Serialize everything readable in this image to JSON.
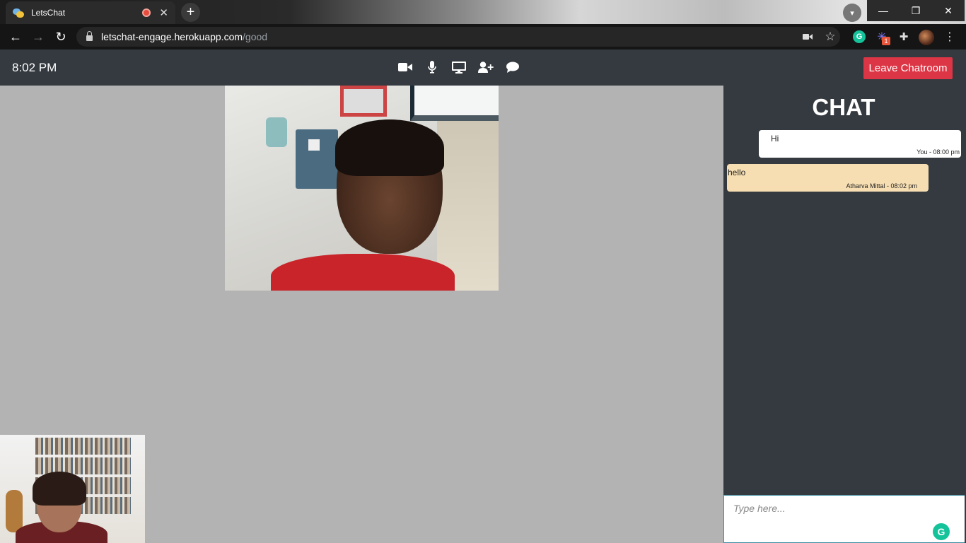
{
  "browser": {
    "tab": {
      "title": "LetsChat"
    },
    "new_tab_symbol": "+",
    "window_controls": {
      "minimize": "—",
      "restore": "❐",
      "close": "✕"
    },
    "nav": {
      "back": "←",
      "forward": "→",
      "reload": "↻"
    },
    "url": {
      "host": "letschat-engage.herokuapp.com",
      "path": "/good"
    },
    "extensions": {
      "grammarly_letter": "G",
      "badge_count": "1"
    }
  },
  "app": {
    "clock": "8:02 PM",
    "controls": [
      {
        "name": "camera-toggle",
        "icon": "video-camera-icon"
      },
      {
        "name": "mic-toggle",
        "icon": "microphone-icon"
      },
      {
        "name": "screen-share",
        "icon": "desktop-icon"
      },
      {
        "name": "invite-user",
        "icon": "user-plus-icon"
      },
      {
        "name": "chat-toggle",
        "icon": "comment-icon"
      }
    ],
    "leave_label": "Leave Chatroom",
    "colors": {
      "header_bg": "#343a40",
      "leave_bg": "#dc3545",
      "video_bg": "#b3b3b3",
      "own_bubble": "#ffffff",
      "other_bubble": "#f6deb2"
    }
  },
  "chat": {
    "title": "CHAT",
    "messages": [
      {
        "text": "Hi",
        "meta": "You - 08:00 pm"
      },
      {
        "text": "hello",
        "meta": "Atharva Mittal - 08:02 pm"
      }
    ],
    "input_placeholder": "Type here...",
    "grammarly_letter": "G"
  }
}
